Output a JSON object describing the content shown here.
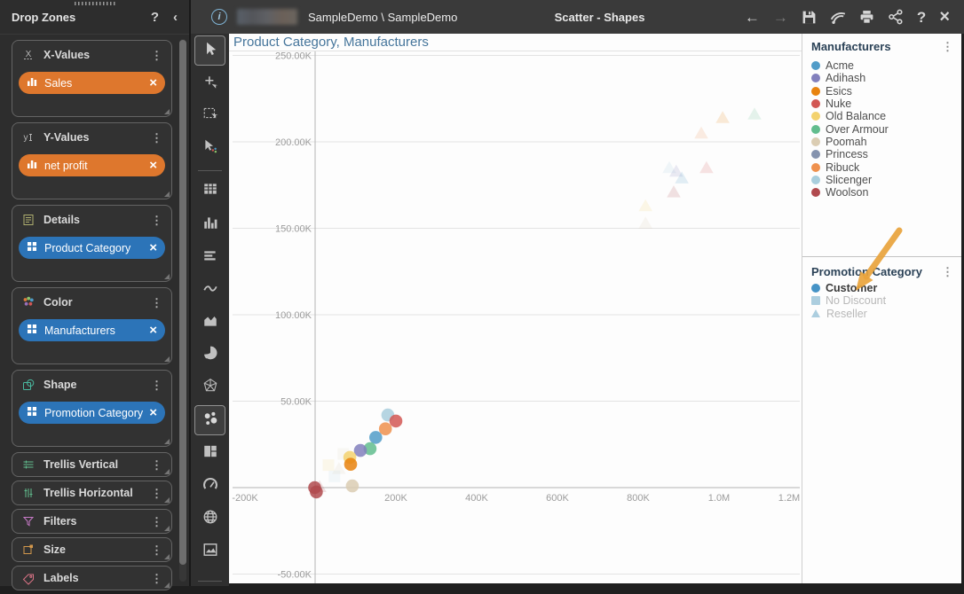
{
  "topbar": {
    "breadcrumb": "SampleDemo \\ SampleDemo",
    "center_title": "Scatter - Shapes",
    "info_glyph": "i",
    "back_glyph": "←",
    "forward_glyph": "→",
    "help_glyph": "?",
    "close_glyph": "×"
  },
  "sidebar": {
    "title": "Drop Zones",
    "help_glyph": "?",
    "collapse_glyph": "‹",
    "kebab_glyph": "⋮",
    "chip_close_glyph": "×",
    "sections": [
      {
        "label": "X-Values",
        "icon": "x-axis-icon",
        "chip": {
          "label": "Sales",
          "type": "measure"
        }
      },
      {
        "label": "Y-Values",
        "icon": "y-axis-icon",
        "chip": {
          "label": "net profit",
          "type": "measure"
        }
      },
      {
        "label": "Details",
        "icon": "details-icon",
        "chip": {
          "label": "Product Category",
          "type": "dimension"
        }
      },
      {
        "label": "Color",
        "icon": "color-icon",
        "chip": {
          "label": "Manufacturers",
          "type": "dimension"
        }
      },
      {
        "label": "Shape",
        "icon": "shape-icon",
        "chip": {
          "label": "Promotion Category",
          "type": "dimension"
        }
      },
      {
        "label": "Trellis Vertical",
        "icon": "trellis-vertical-icon",
        "collapsed": true
      },
      {
        "label": "Trellis Horizontal",
        "icon": "trellis-horizontal-icon",
        "collapsed": true
      },
      {
        "label": "Filters",
        "icon": "filters-icon",
        "collapsed": true
      },
      {
        "label": "Size",
        "icon": "size-icon",
        "collapsed": true
      },
      {
        "label": "Labels",
        "icon": "labels-icon",
        "collapsed": true
      }
    ]
  },
  "toolbar": {
    "items": [
      {
        "name": "pointer-tool",
        "selected": true
      },
      {
        "name": "pan-tool",
        "selected": false
      },
      {
        "name": "rectangle-select-tool",
        "selected": false
      },
      {
        "name": "point-select-tool",
        "selected": false
      },
      {
        "name": "table-viz",
        "selected": false
      },
      {
        "name": "bar-chart-viz",
        "selected": false
      },
      {
        "name": "text-lines-viz",
        "selected": false
      },
      {
        "name": "line-chart-viz",
        "selected": false
      },
      {
        "name": "area-chart-viz",
        "selected": false
      },
      {
        "name": "pie-chart-viz",
        "selected": false
      },
      {
        "name": "radar-chart-viz",
        "selected": false
      },
      {
        "name": "scatter-plot-viz",
        "selected": true
      },
      {
        "name": "treemap-viz",
        "selected": false
      },
      {
        "name": "gauge-viz",
        "selected": false
      },
      {
        "name": "map-viz",
        "selected": false
      },
      {
        "name": "image-viz",
        "selected": false
      }
    ]
  },
  "legend": {
    "manufacturers": {
      "title": "Manufacturers",
      "items": [
        {
          "label": "Acme",
          "color": "#519CC8"
        },
        {
          "label": "Adihash",
          "color": "#8280BD"
        },
        {
          "label": "Esics",
          "color": "#E8830F"
        },
        {
          "label": "Nuke",
          "color": "#D25754"
        },
        {
          "label": "Old Balance",
          "color": "#F3D26E"
        },
        {
          "label": "Over Armour",
          "color": "#62BD8E"
        },
        {
          "label": "Poomah",
          "color": "#DBCDB3"
        },
        {
          "label": "Princess",
          "color": "#8593AE"
        },
        {
          "label": "Ribuck",
          "color": "#EF914E"
        },
        {
          "label": "Slicenger",
          "color": "#A9CEDD"
        },
        {
          "label": "Woolson",
          "color": "#B04A4E"
        }
      ]
    },
    "promotion": {
      "title": "Promotion Category",
      "arrow_points_to": "Customer",
      "arrow_color": "#E9A43C",
      "items": [
        {
          "label": "Customer",
          "shape": "circle",
          "color": "#4593C6",
          "active": true
        },
        {
          "label": "No Discount",
          "shape": "square",
          "color": "#ACCEDF",
          "active": false
        },
        {
          "label": "Reseller",
          "shape": "triangle",
          "color": "#ACCEDF",
          "active": false
        }
      ]
    }
  },
  "chart_data": {
    "type": "scatter",
    "title": "Product Category, Manufacturers",
    "grid": "horizontal",
    "legend_position": "right",
    "xlim": [
      -213000,
      1205000
    ],
    "ylim": [
      -56000,
      256000
    ],
    "x_axis": {
      "ticks": [
        {
          "v": -200000,
          "label": "-200K"
        },
        {
          "v": 200000,
          "label": "200K"
        },
        {
          "v": 400000,
          "label": "400K"
        },
        {
          "v": 600000,
          "label": "600K"
        },
        {
          "v": 800000,
          "label": "800K"
        },
        {
          "v": 1000000,
          "label": "1.0M"
        },
        {
          "v": 1200000,
          "label": "1.2M"
        }
      ]
    },
    "y_axis": {
      "ticks": [
        {
          "v": 250000,
          "label": "250.00K"
        },
        {
          "v": 200000,
          "label": "200.00K"
        },
        {
          "v": 150000,
          "label": "150.00K"
        },
        {
          "v": 100000,
          "label": "100.00K"
        },
        {
          "v": 50000,
          "label": "50.00K"
        },
        {
          "v": -50000,
          "label": "-50.00K"
        }
      ]
    },
    "series": [
      {
        "name": "Customer",
        "marker": "circle",
        "opacity": 0.85,
        "points": [
          {
            "manufacturer": "Slicenger",
            "x": 180000,
            "y": 42000
          },
          {
            "manufacturer": "Nuke",
            "x": 200000,
            "y": 38500
          },
          {
            "manufacturer": "Ribuck",
            "x": 174000,
            "y": 34000
          },
          {
            "manufacturer": "Acme",
            "x": 150000,
            "y": 29000
          },
          {
            "manufacturer": "Over Armour",
            "x": 136000,
            "y": 22500
          },
          {
            "manufacturer": "Adihash",
            "x": 112000,
            "y": 21500
          },
          {
            "manufacturer": "Old Balance",
            "x": 86000,
            "y": 17500
          },
          {
            "manufacturer": "Esics",
            "x": 88000,
            "y": 13500
          },
          {
            "manufacturer": "Poomah",
            "x": 92000,
            "y": 1000
          },
          {
            "manufacturer": "Woolson",
            "x": -1000,
            "y": 0
          },
          {
            "manufacturer": "Woolson",
            "x": 3000,
            "y": -2500
          }
        ]
      },
      {
        "name": "Reseller",
        "marker": "triangle",
        "opacity": 0.16,
        "points": [
          {
            "manufacturer": "Esics",
            "x": 1009000,
            "y": 214000
          },
          {
            "manufacturer": "Over Armour",
            "x": 1088000,
            "y": 216000
          },
          {
            "manufacturer": "Ribuck",
            "x": 956000,
            "y": 205000
          },
          {
            "manufacturer": "Slicenger",
            "x": 877000,
            "y": 185000
          },
          {
            "manufacturer": "Adihash",
            "x": 894000,
            "y": 183000
          },
          {
            "manufacturer": "Acme",
            "x": 908000,
            "y": 179000
          },
          {
            "manufacturer": "Nuke",
            "x": 969000,
            "y": 185000
          },
          {
            "manufacturer": "Woolson",
            "x": 888000,
            "y": 171000
          },
          {
            "manufacturer": "Old Balance",
            "x": 818000,
            "y": 163000
          },
          {
            "manufacturer": "Poomah",
            "x": 818000,
            "y": 153000
          },
          {
            "manufacturer": "Poomah",
            "x": 59000,
            "y": 11000
          },
          {
            "manufacturer": "Woolson",
            "x": 11000,
            "y": 500
          }
        ]
      },
      {
        "name": "No Discount",
        "marker": "square",
        "opacity": 0.13,
        "points": [
          {
            "manufacturer": "Slicenger",
            "x": 48000,
            "y": 6500
          },
          {
            "manufacturer": "Poomah",
            "x": 70000,
            "y": 19500
          },
          {
            "manufacturer": "Old Balance",
            "x": 33000,
            "y": 13000
          }
        ]
      }
    ]
  }
}
